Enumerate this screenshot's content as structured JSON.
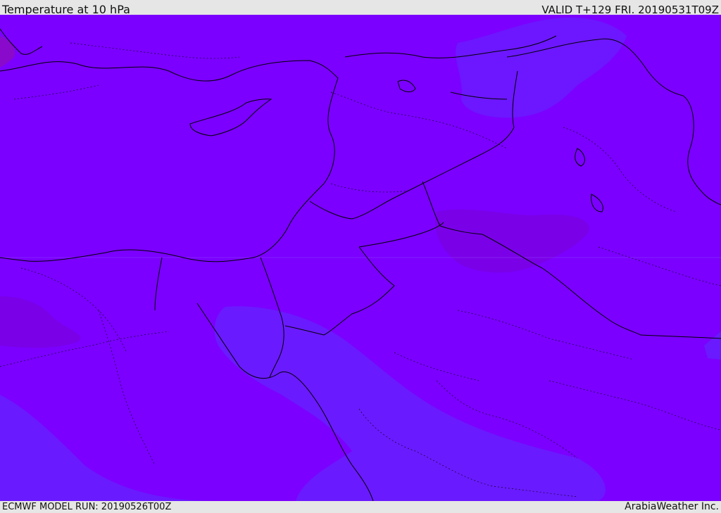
{
  "header": {
    "title": "Temperature at 10 hPa",
    "valid_time": "VALID T+129 FRI. 20190531T09Z"
  },
  "footer": {
    "model_run": "ECMWF MODEL RUN: 20190526T00Z",
    "credit": "ArabiaWeather Inc."
  },
  "colors": {
    "base_fill": "#7b00ff",
    "cool_fill": "#6a1aff",
    "warm_fill": "#7a00e8",
    "border_line": "#000000",
    "chrome": "#e6e6e6"
  }
}
